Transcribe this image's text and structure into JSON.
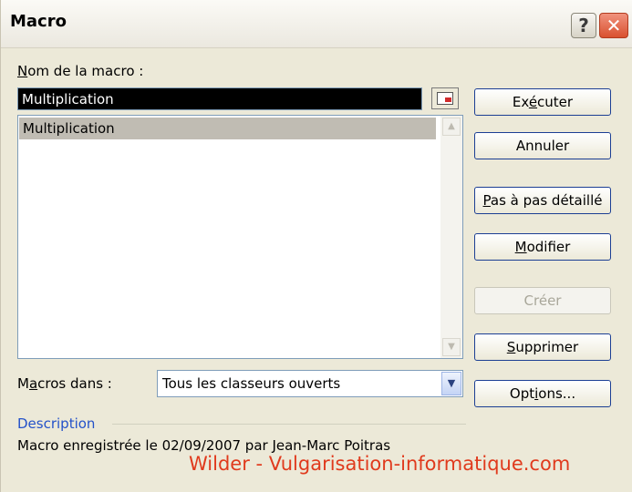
{
  "window": {
    "title": "Macro",
    "help_label": "?",
    "close_label": "✕"
  },
  "macro_name": {
    "label_underlined": "N",
    "label_rest": "om de la macro :",
    "value": "Multiplication"
  },
  "macro_list": {
    "items": [
      "Multiplication"
    ]
  },
  "buttons": {
    "run_pre": "Ex",
    "run_u": "é",
    "run_post": "cuter",
    "cancel": "Annuler",
    "step_u": "P",
    "step_rest": "as à pas détaillé",
    "edit_u": "M",
    "edit_rest": "odifier",
    "create": "Créer",
    "delete_u": "S",
    "delete_rest": "upprimer",
    "options_pre": "Opt",
    "options_u": "i",
    "options_post": "ons..."
  },
  "macros_in": {
    "label_pre": "M",
    "label_u": "a",
    "label_post": "cros dans :",
    "selected": "Tous les classeurs ouverts"
  },
  "description": {
    "heading": "Description",
    "text": "Macro enregistrée le 02/09/2007 par Jean-Marc Poitras"
  },
  "watermark": "Wilder - Vulgarisation-informatique.com",
  "colors": {
    "button_border": "#1c3f94",
    "description_heading": "#2452c9",
    "watermark": "#e03a1d",
    "selection": "#c0bcb3"
  }
}
